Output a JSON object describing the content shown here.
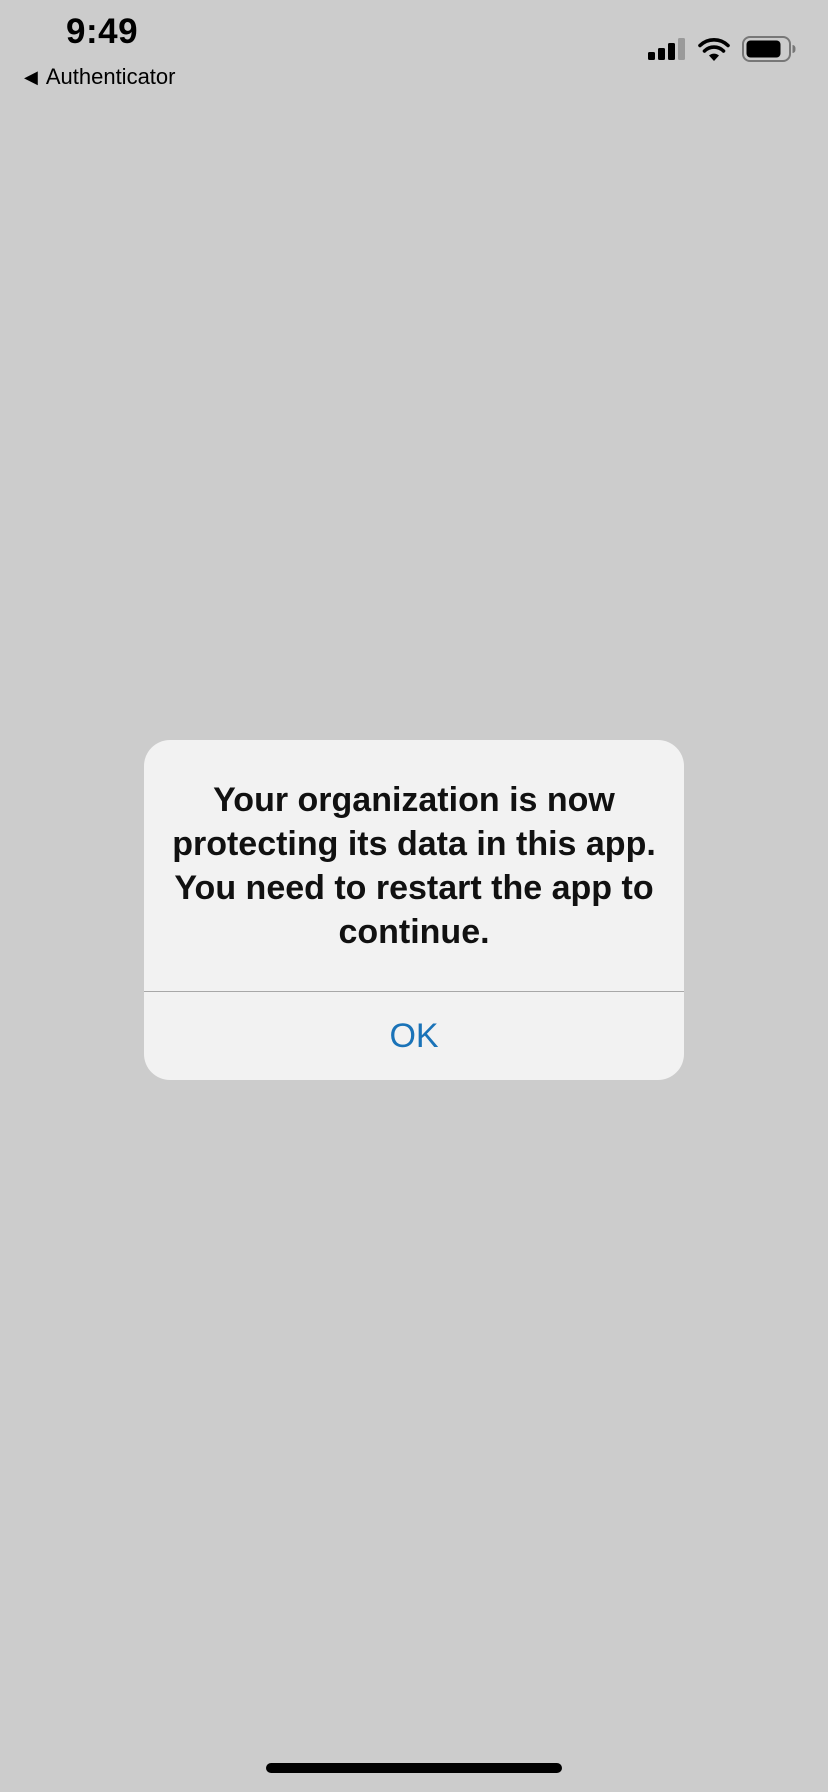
{
  "status_bar": {
    "time": "9:49",
    "back_arrow": "◀",
    "back_label": "Authenticator",
    "icons": [
      "signal-icon",
      "wifi-icon",
      "battery-icon"
    ]
  },
  "alert": {
    "message": "Your organization is now protecting its data in this app. You need to restart the app to continue.",
    "ok_label": "OK",
    "button_color": "#1a73b8"
  },
  "colors": {
    "background": "#cccccc",
    "alert_background": "#f2f2f2"
  }
}
